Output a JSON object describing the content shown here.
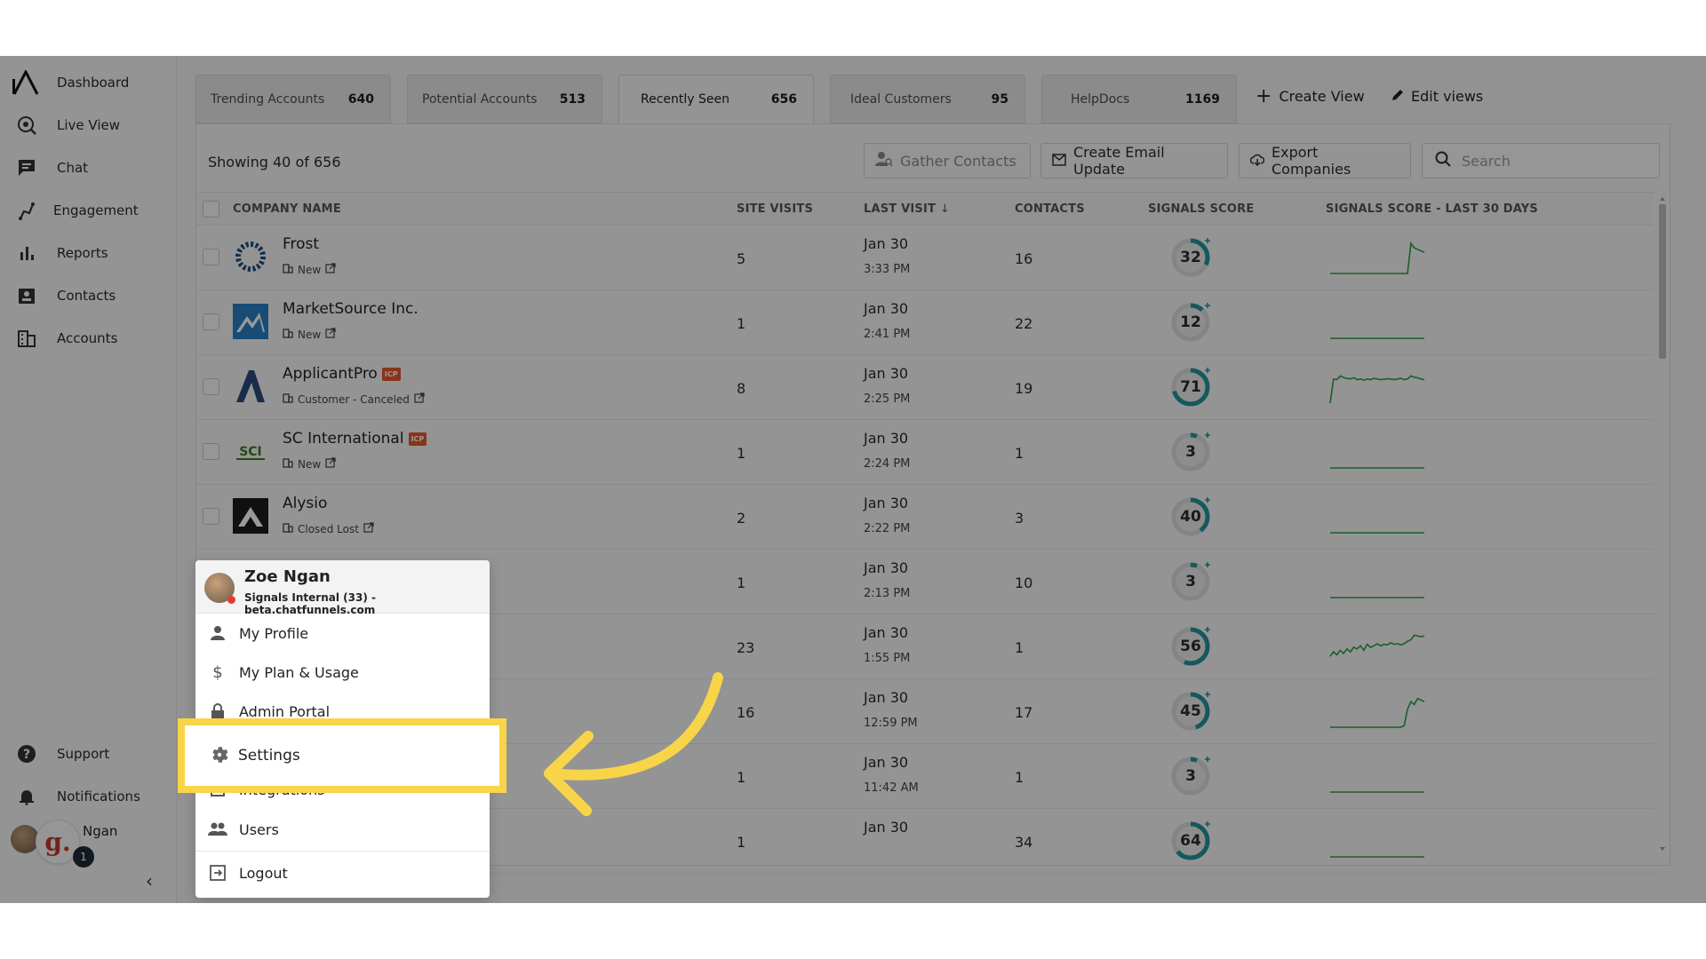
{
  "sidebar": {
    "items": [
      {
        "label": "Dashboard",
        "icon": "logo-icon"
      },
      {
        "label": "Live View",
        "icon": "live-view-icon"
      },
      {
        "label": "Chat",
        "icon": "chat-icon"
      },
      {
        "label": "Engagement",
        "icon": "engagement-icon"
      },
      {
        "label": "Reports",
        "icon": "reports-icon"
      },
      {
        "label": "Contacts",
        "icon": "contacts-icon"
      },
      {
        "label": "Accounts",
        "icon": "accounts-icon"
      }
    ],
    "support_label": "Support",
    "notifications_label": "Notifications",
    "user_short_name": "Ngan",
    "g_badge": "g.",
    "notification_count": "1",
    "collapse_glyph": "‹"
  },
  "tabs": [
    {
      "label": "Trending Accounts",
      "count": "640"
    },
    {
      "label": "Potential Accounts",
      "count": "513"
    },
    {
      "label": "Recently Seen",
      "count": "656"
    },
    {
      "label": "Ideal Customers",
      "count": "95"
    },
    {
      "label": "HelpDocs",
      "count": "1169"
    }
  ],
  "tab_actions": {
    "create_view": "Create View",
    "edit_views": "Edit views"
  },
  "toolbar": {
    "showing": "Showing 40 of  656",
    "gather_contacts": "Gather Contacts",
    "create_email_update": "Create Email Update",
    "export_companies": "Export Companies",
    "search_placeholder": "Search"
  },
  "table": {
    "headers": {
      "company": "COMPANY NAME",
      "site_visits": "SITE VISITS",
      "last_visit": "LAST VISIT",
      "last_visit_sort": "↓",
      "contacts": "CONTACTS",
      "signals_score": "SIGNALS SCORE",
      "signals_30": "SIGNALS SCORE - LAST 30 DAYS"
    },
    "rows": [
      {
        "name": "Frost",
        "icp": "",
        "status": "New",
        "visits": "5",
        "date": "Jan 30",
        "time": "3:33 PM",
        "contacts": "16",
        "score": 32,
        "spark": [
          0,
          0,
          0,
          0,
          0,
          0,
          0,
          0,
          0,
          0,
          0,
          0,
          0,
          0,
          0,
          0,
          0,
          0,
          0,
          0,
          0,
          0,
          0,
          0,
          1,
          0.85,
          0.8,
          0.75,
          0.7
        ]
      },
      {
        "name": "MarketSource Inc.",
        "icp": "",
        "status": "New",
        "visits": "1",
        "date": "Jan 30",
        "time": "2:41 PM",
        "contacts": "22",
        "score": 12,
        "spark": [
          0,
          0,
          0,
          0,
          0,
          0,
          0,
          0,
          0,
          0,
          0,
          0,
          0,
          0,
          0,
          0,
          0,
          0,
          0,
          0,
          0,
          0,
          0,
          0,
          0,
          0,
          0,
          0,
          0
        ]
      },
      {
        "name": "ApplicantPro",
        "icp": "ICP",
        "status": "Customer - Canceled",
        "visits": "8",
        "date": "Jan 30",
        "time": "2:25 PM",
        "contacts": "19",
        "score": 71,
        "spark": [
          0,
          0.8,
          0.78,
          0.9,
          0.85,
          0.82,
          0.8,
          0.84,
          0.78,
          0.8,
          0.76,
          0.8,
          0.78,
          0.82,
          0.8,
          0.78,
          0.79,
          0.81,
          0.8,
          0.78,
          0.8,
          0.82,
          0.78,
          0.8,
          0.9,
          0.86,
          0.84,
          0.8,
          0.78
        ]
      },
      {
        "name": "SC International",
        "icp": "ICP",
        "status": "New",
        "visits": "1",
        "date": "Jan 30",
        "time": "2:24 PM",
        "contacts": "1",
        "score": 3,
        "spark": [
          0,
          0,
          0,
          0,
          0,
          0,
          0,
          0,
          0,
          0,
          0,
          0,
          0,
          0,
          0,
          0,
          0,
          0,
          0,
          0,
          0,
          0,
          0,
          0,
          0,
          0,
          0,
          0,
          0
        ]
      },
      {
        "name": "Alysio",
        "icp": "",
        "status": "Closed Lost",
        "visits": "2",
        "date": "Jan 30",
        "time": "2:22 PM",
        "contacts": "3",
        "score": 40,
        "spark": [
          0,
          0,
          0,
          0,
          0,
          0,
          0,
          0,
          0,
          0,
          0,
          0,
          0,
          0,
          0,
          0,
          0,
          0,
          0,
          0,
          0,
          0,
          0,
          0,
          0,
          0,
          0,
          0,
          0
        ]
      },
      {
        "name": "",
        "icp": "",
        "status": "",
        "visits": "1",
        "date": "Jan 30",
        "time": "2:13 PM",
        "contacts": "10",
        "score": 3,
        "spark": [
          0,
          0,
          0,
          0,
          0,
          0,
          0,
          0,
          0,
          0,
          0,
          0,
          0,
          0,
          0,
          0,
          0,
          0,
          0,
          0,
          0,
          0,
          0,
          0,
          0,
          0,
          0,
          0,
          0
        ]
      },
      {
        "name": "",
        "icp": "",
        "status": "",
        "visits": "23",
        "date": "Jan 30",
        "time": "1:55 PM",
        "contacts": "1",
        "score": 56,
        "spark": [
          0.2,
          0.35,
          0.25,
          0.4,
          0.3,
          0.45,
          0.35,
          0.5,
          0.45,
          0.55,
          0.4,
          0.6,
          0.5,
          0.55,
          0.62,
          0.55,
          0.6,
          0.58,
          0.65,
          0.6,
          0.62,
          0.58,
          0.62,
          0.7,
          0.75,
          0.9,
          0.88,
          0.85,
          0.88
        ]
      },
      {
        "name": "",
        "icp": "",
        "status": "",
        "visits": "16",
        "date": "Jan 30",
        "time": "12:59 PM",
        "contacts": "17",
        "score": 45,
        "spark": [
          0,
          0,
          0,
          0,
          0,
          0,
          0,
          0,
          0,
          0,
          0,
          0,
          0,
          0,
          0,
          0,
          0,
          0,
          0,
          0,
          0,
          0,
          0.05,
          0.6,
          0.85,
          0.75,
          0.95,
          0.9,
          0.85
        ]
      },
      {
        "name": "",
        "icp": "",
        "status": "",
        "visits": "1",
        "date": "Jan 30",
        "time": "11:42 AM",
        "contacts": "1",
        "score": 3,
        "spark": [
          0,
          0,
          0,
          0,
          0,
          0,
          0,
          0,
          0,
          0,
          0,
          0,
          0,
          0,
          0,
          0,
          0,
          0,
          0,
          0,
          0,
          0,
          0,
          0,
          0,
          0,
          0,
          0,
          0
        ]
      },
      {
        "name": "",
        "icp": "",
        "status": "",
        "visits": "1",
        "date": "Jan 30",
        "time": "",
        "contacts": "34",
        "score": 64,
        "spark": [
          0,
          0,
          0,
          0,
          0,
          0,
          0,
          0,
          0,
          0,
          0,
          0,
          0,
          0,
          0,
          0,
          0,
          0,
          0,
          0,
          0,
          0,
          0,
          0,
          0,
          0,
          0,
          0,
          0
        ]
      }
    ]
  },
  "user_menu": {
    "name": "Zoe Ngan",
    "subtitle": "Signals Internal (33) - beta.chatfunnels.com",
    "items": [
      {
        "label": "My Profile",
        "icon": "person-icon"
      },
      {
        "label": "My Plan & Usage",
        "icon": "dollar-icon"
      },
      {
        "label": "Admin Portal",
        "icon": "lock-icon"
      },
      {
        "label": "Settings",
        "icon": "gear-icon"
      },
      {
        "label": "Integrations",
        "icon": "integrations-icon"
      },
      {
        "label": "Users",
        "icon": "users-icon"
      },
      {
        "label": "Logout",
        "icon": "logout-icon"
      }
    ]
  },
  "colors": {
    "accent": "#21959b",
    "spark": "#2e9e48",
    "highlight": "#f8d548",
    "icp": "#e4572e"
  }
}
